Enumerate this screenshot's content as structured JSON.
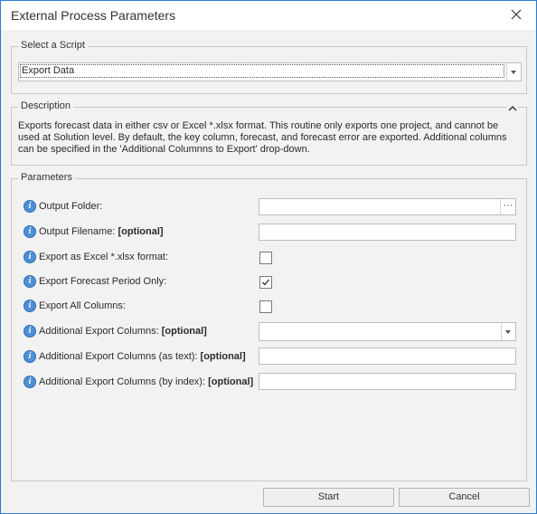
{
  "window": {
    "title": "External Process Parameters"
  },
  "script_group": {
    "label": "Select a Script",
    "selected": "Export Data"
  },
  "description_group": {
    "label": "Description",
    "text_line1": "Exports forecast data in either csv or Excel *.xlsx format. This routine only exports one project, and cannot be",
    "text_line2": "used at Solution level. By default, the key column, forecast, and forecast error are exported. Additional columns",
    "text_line3": "can be specified in the 'Additional Columnns to Export' drop-down."
  },
  "parameters_group": {
    "label": "Parameters",
    "optional_tag": "[optional]",
    "rows": [
      {
        "label": "Output Folder:",
        "optional": false,
        "control": "folder",
        "value": ""
      },
      {
        "label": "Output Filename:",
        "optional": true,
        "control": "text",
        "value": ""
      },
      {
        "label": "Export as Excel *.xlsx format:",
        "optional": false,
        "control": "checkbox",
        "checked": false
      },
      {
        "label": "Export Forecast Period Only:",
        "optional": false,
        "control": "checkbox",
        "checked": true
      },
      {
        "label": "Export All Columns:",
        "optional": false,
        "control": "checkbox",
        "checked": false
      },
      {
        "label": "Additional Export Columns:",
        "optional": true,
        "control": "dropdown",
        "value": ""
      },
      {
        "label": "Additional Export Columns (as text):",
        "optional": true,
        "control": "text",
        "value": ""
      },
      {
        "label": "Additional Export Columns (by index):",
        "optional": true,
        "control": "text",
        "value": ""
      }
    ],
    "browse_button": "···"
  },
  "buttons": {
    "start": "Start",
    "cancel": "Cancel"
  },
  "colors": {
    "window_border": "#2b79d0",
    "info_icon": "#4f8fd6",
    "background": "#f2f2f2"
  },
  "icons": {
    "close": "close-icon",
    "info": "info-icon",
    "collapse": "chevron-up-icon",
    "dropdown": "chevron-down-icon"
  }
}
